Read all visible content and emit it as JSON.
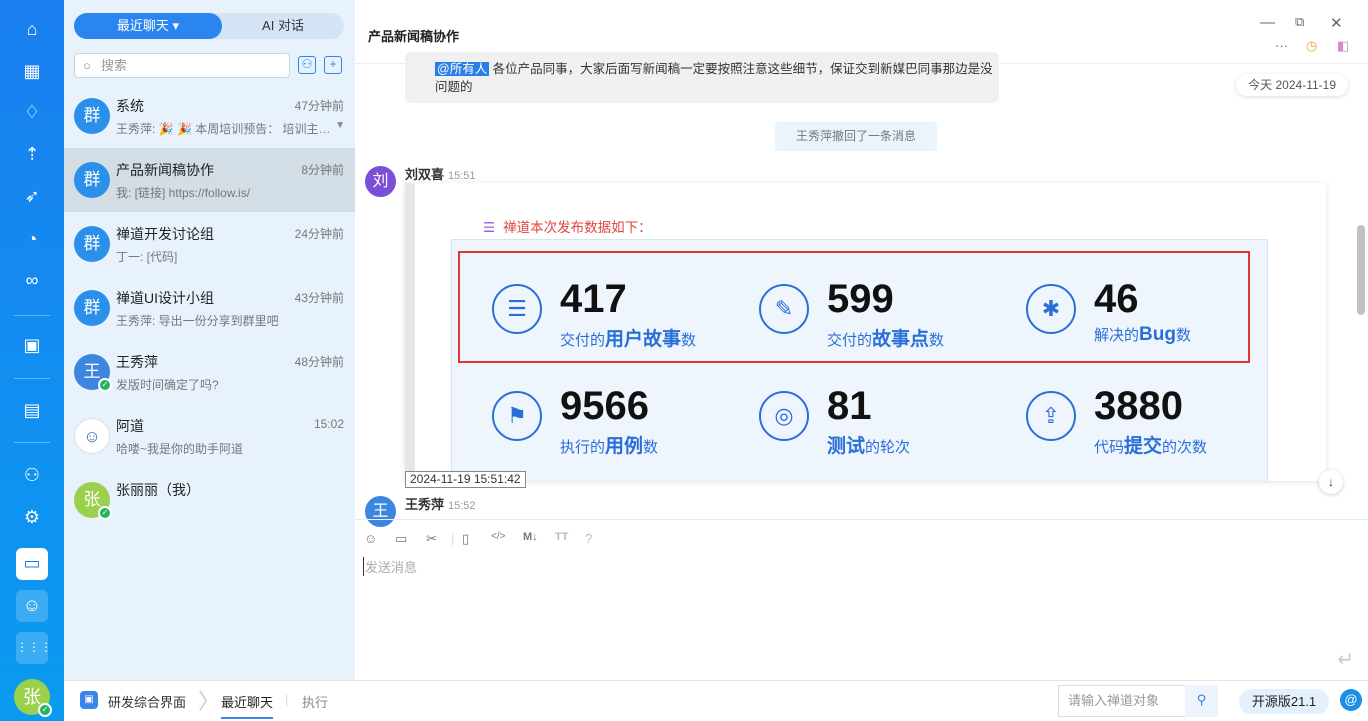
{
  "nav": {
    "icons": [
      "home-icon",
      "apps-icon",
      "bulb-icon",
      "rocket-icon",
      "runner-icon",
      "search-test-icon",
      "infinity-icon",
      "board-icon",
      "doc-icon",
      "users-icon",
      "gear-icon",
      "chat-icon",
      "contact-icon",
      "more-apps-icon"
    ],
    "me_avatar": "张"
  },
  "list": {
    "tabs": {
      "recent": "最近聊天 ▾",
      "ai": "AI 对话"
    },
    "search_placeholder": "搜索",
    "items": [
      {
        "avatar": "群",
        "name": "系统",
        "time": "47分钟前",
        "preview": "王秀萍: 🎉 🎉 本周培训预告： 培训主…"
      },
      {
        "avatar": "群",
        "name": "产品新闻稿协作",
        "time": "8分钟前",
        "preview": "我: [链接] https://follow.is/"
      },
      {
        "avatar": "群",
        "name": "禅道开发讨论组",
        "time": "24分钟前",
        "preview": "丁一: [代码]"
      },
      {
        "avatar": "群",
        "name": "禅道UI设计小组",
        "time": "43分钟前",
        "preview": "王秀萍: 导出一份分享到群里吧"
      },
      {
        "avatar": "王",
        "name": "王秀萍",
        "time": "48分钟前",
        "preview": "发版时间确定了吗?"
      },
      {
        "avatar": "☺",
        "name": "阿道",
        "time": "15:02",
        "preview": "哈喽~我是你的助手阿道"
      },
      {
        "avatar": "张",
        "name": "张丽丽（我）",
        "time": "",
        "preview": ""
      }
    ]
  },
  "chat": {
    "title": "产品新闻稿协作",
    "bubble": {
      "mention": "@所有人",
      "text": " 各位产品同事，大家后面写新闻稿一定要按照注意这些细节，保证交到新媒巴同事那边是没问题的"
    },
    "date_badge": "今天 2024-11-19",
    "recall": "王秀萍撤回了一条消息",
    "msg1": {
      "avatar": "刘",
      "sender": "刘双喜",
      "time": "15:51"
    },
    "card": {
      "title": "禅道本次发布数据如下：",
      "stats": [
        {
          "icon": "☰",
          "value": "417",
          "pre": "交付的",
          "bold": "用户故事",
          "post": "数"
        },
        {
          "icon": "✎",
          "value": "599",
          "pre": "交付的",
          "bold": "故事点",
          "post": "数"
        },
        {
          "icon": "✱",
          "value": "46",
          "pre": "解决的",
          "bold": "Bug",
          "post": "数"
        },
        {
          "icon": "⚑",
          "value": "9566",
          "pre": "执行的",
          "bold": "用例",
          "post": "数"
        },
        {
          "icon": "◎",
          "value": "81",
          "pre": "",
          "bold": "测试",
          "post": "的轮次"
        },
        {
          "icon": "⇪",
          "value": "3880",
          "pre": "代码",
          "bold": "提交",
          "post": "的次数"
        }
      ]
    },
    "tooltip": "2024-11-19 15:51:42",
    "msg2": {
      "avatar": "王",
      "sender": "王秀萍",
      "time": "15:52"
    },
    "input_placeholder": "发送消息"
  },
  "footer": {
    "app": "研发综合界面",
    "tab_active": "最近聊天",
    "tab2": "执行",
    "search_placeholder": "请输入禅道对象",
    "version": "开源版21.1"
  }
}
